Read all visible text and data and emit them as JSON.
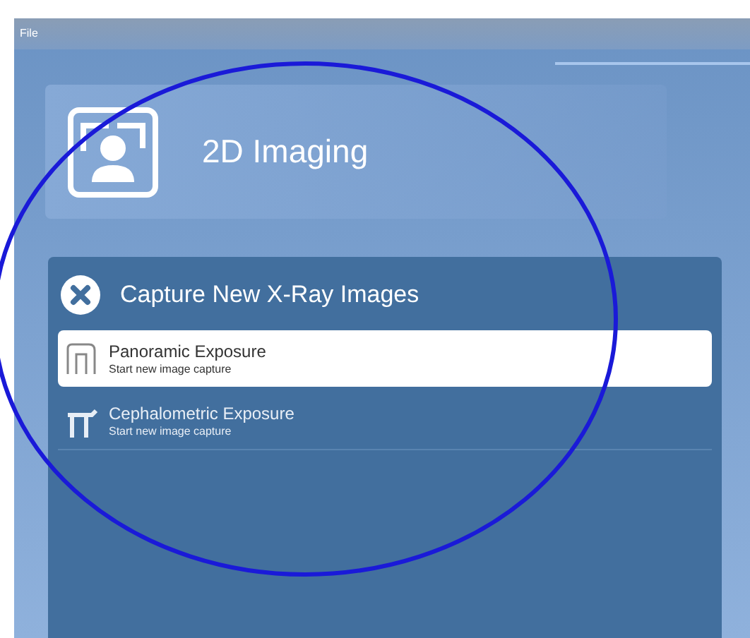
{
  "menu_bar": {
    "items": [
      "File"
    ]
  },
  "module_tile": {
    "title": "2D Imaging"
  },
  "capture_panel": {
    "title": "Capture New X-Ray Images",
    "items": [
      {
        "kind": "panoramic",
        "title": "Panoramic Exposure",
        "subtitle": "Start new image capture",
        "selected": true
      },
      {
        "kind": "cephalometric",
        "title": "Cephalometric Exposure",
        "subtitle": "Start new image capture",
        "selected": false
      }
    ]
  }
}
